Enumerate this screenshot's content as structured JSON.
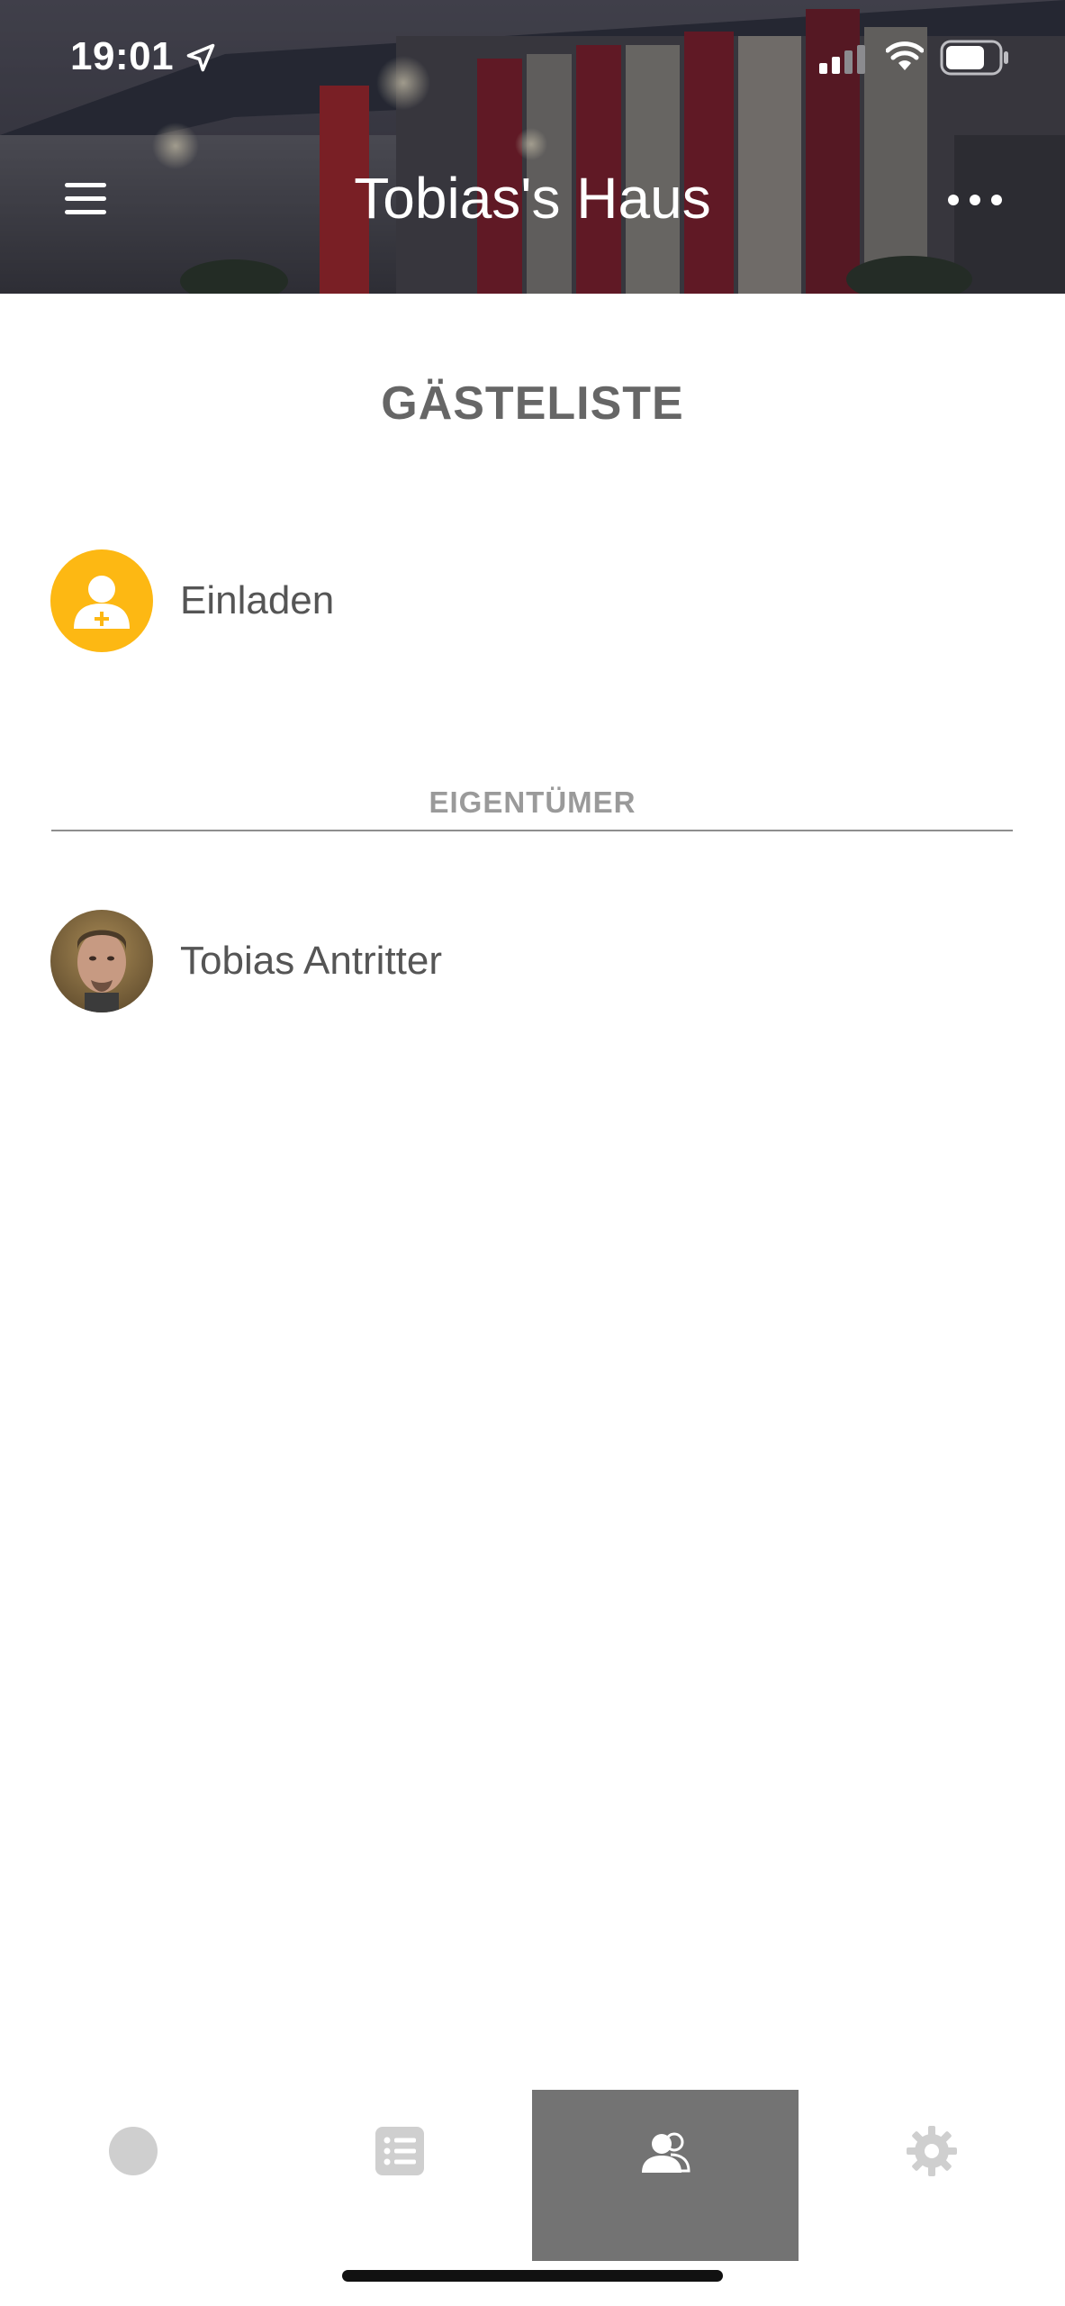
{
  "status_bar": {
    "time": "19:01",
    "icons": [
      "location-arrow-icon",
      "cellular-signal-icon",
      "wifi-icon",
      "battery-icon"
    ]
  },
  "header": {
    "title": "Tobias's Haus",
    "left_icon": "hamburger-menu-icon",
    "right_icon": "more-dots-icon"
  },
  "main": {
    "section_title": "GÄSTELISTE",
    "invite": {
      "label": "Einladen",
      "icon": "add-user-icon",
      "color": "#FDB813"
    },
    "groups": [
      {
        "label": "EIGENTÜMER",
        "members": [
          {
            "name": "Tobias Antritter",
            "avatar": "user-photo"
          }
        ]
      }
    ]
  },
  "tab_bar": {
    "tabs": [
      {
        "icon": "home-circle-icon",
        "active": false
      },
      {
        "icon": "list-icon",
        "active": false
      },
      {
        "icon": "users-icon",
        "active": true
      },
      {
        "icon": "gear-icon",
        "active": false
      }
    ],
    "active_color": "#737373",
    "inactive_icon_color": "#cfcfcf"
  }
}
